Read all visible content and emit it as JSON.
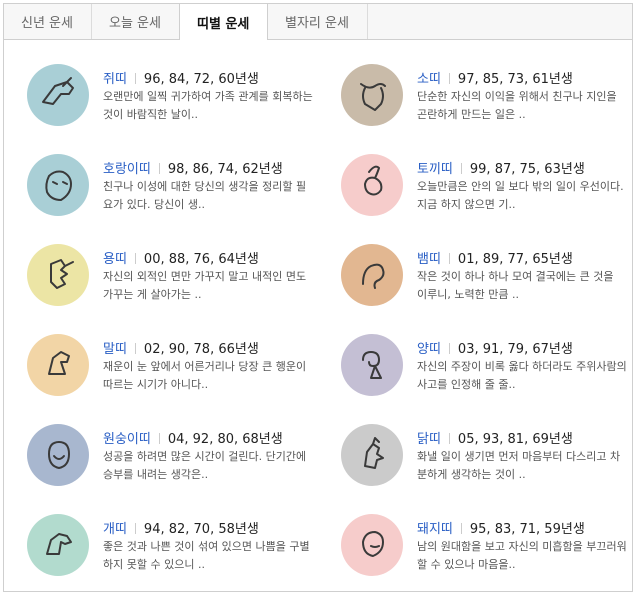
{
  "tabs": [
    "신년 운세",
    "오늘 운세",
    "띠별 운세",
    "별자리 운세"
  ],
  "active_tab": "띠별 운세",
  "zodiac": [
    {
      "name": "쥐띠",
      "years": "96, 84, 72, 60년생",
      "desc": "오랜만에 일찍 귀가하여 가족 관계를 회복하는 것이 바람직한 날이..",
      "icon": "rat-icon",
      "color": "#a9cfd6"
    },
    {
      "name": "소띠",
      "years": "97, 85, 73, 61년생",
      "desc": "단순한 자신의 이익을 위해서 친구나 지인을 곤란하게 만드는 일은 ..",
      "icon": "ox-icon",
      "color": "#c9bba9"
    },
    {
      "name": "호랑이띠",
      "years": "98, 86, 74, 62년생",
      "desc": "친구나 이성에 대한 당신의 생각을 정리할 필요가 있다. 당신이 생..",
      "icon": "tiger-icon",
      "color": "#a9cfd6"
    },
    {
      "name": "토끼띠",
      "years": "99, 87, 75, 63년생",
      "desc": "오늘만큼은 안의 일 보다 밖의 일이 우선이다. 지금 하지 않으면 기..",
      "icon": "rabbit-icon",
      "color": "#f6cccb"
    },
    {
      "name": "용띠",
      "years": "00, 88, 76, 64년생",
      "desc": "자신의 외적인 면만 가꾸지 말고 내적인 면도 가꾸는 게 살아가는 ..",
      "icon": "dragon-icon",
      "color": "#ece5a5"
    },
    {
      "name": "뱀띠",
      "years": "01, 89, 77, 65년생",
      "desc": "작은 것이 하나 하나 모여 결국에는 큰 것을 이루니, 노력한 만큼 ..",
      "icon": "snake-icon",
      "color": "#e2b791"
    },
    {
      "name": "말띠",
      "years": "02, 90, 78, 66년생",
      "desc": "재운이 눈 앞에서 어른거리나 당장 큰 행운이 따르는 시기가 아니다..",
      "icon": "horse-icon",
      "color": "#f2d5a6"
    },
    {
      "name": "양띠",
      "years": "03, 91, 79, 67년생",
      "desc": "자신의 주장이 비록 옳다 하더라도 주위사람의 사고를 인정해 줄 줄..",
      "icon": "sheep-icon",
      "color": "#c4bfd4"
    },
    {
      "name": "원숭이띠",
      "years": "04, 92, 80, 68년생",
      "desc": "성공을 하려면 많은 시간이 걸린다. 단기간에 승부를 내려는 생각은..",
      "icon": "monkey-icon",
      "color": "#a8b7cf"
    },
    {
      "name": "닭띠",
      "years": "05, 93, 81, 69년생",
      "desc": "화낼 일이 생기면 먼저 마음부터 다스리고 차분하게 생각하는 것이 ..",
      "icon": "rooster-icon",
      "color": "#cbcbcb"
    },
    {
      "name": "개띠",
      "years": "94, 82, 70, 58년생",
      "desc": "좋은 것과 나쁜 것이 섞여 있으면 나쁨을 구별하지 못할 수 있으니 ..",
      "icon": "dog-icon",
      "color": "#b2dbce"
    },
    {
      "name": "돼지띠",
      "years": "95, 83, 71, 59년생",
      "desc": "남의 원대함을 보고 자신의 미흡함을 부끄러워 할 수 있으나 마음을..",
      "icon": "pig-icon",
      "color": "#f6cccb"
    }
  ]
}
